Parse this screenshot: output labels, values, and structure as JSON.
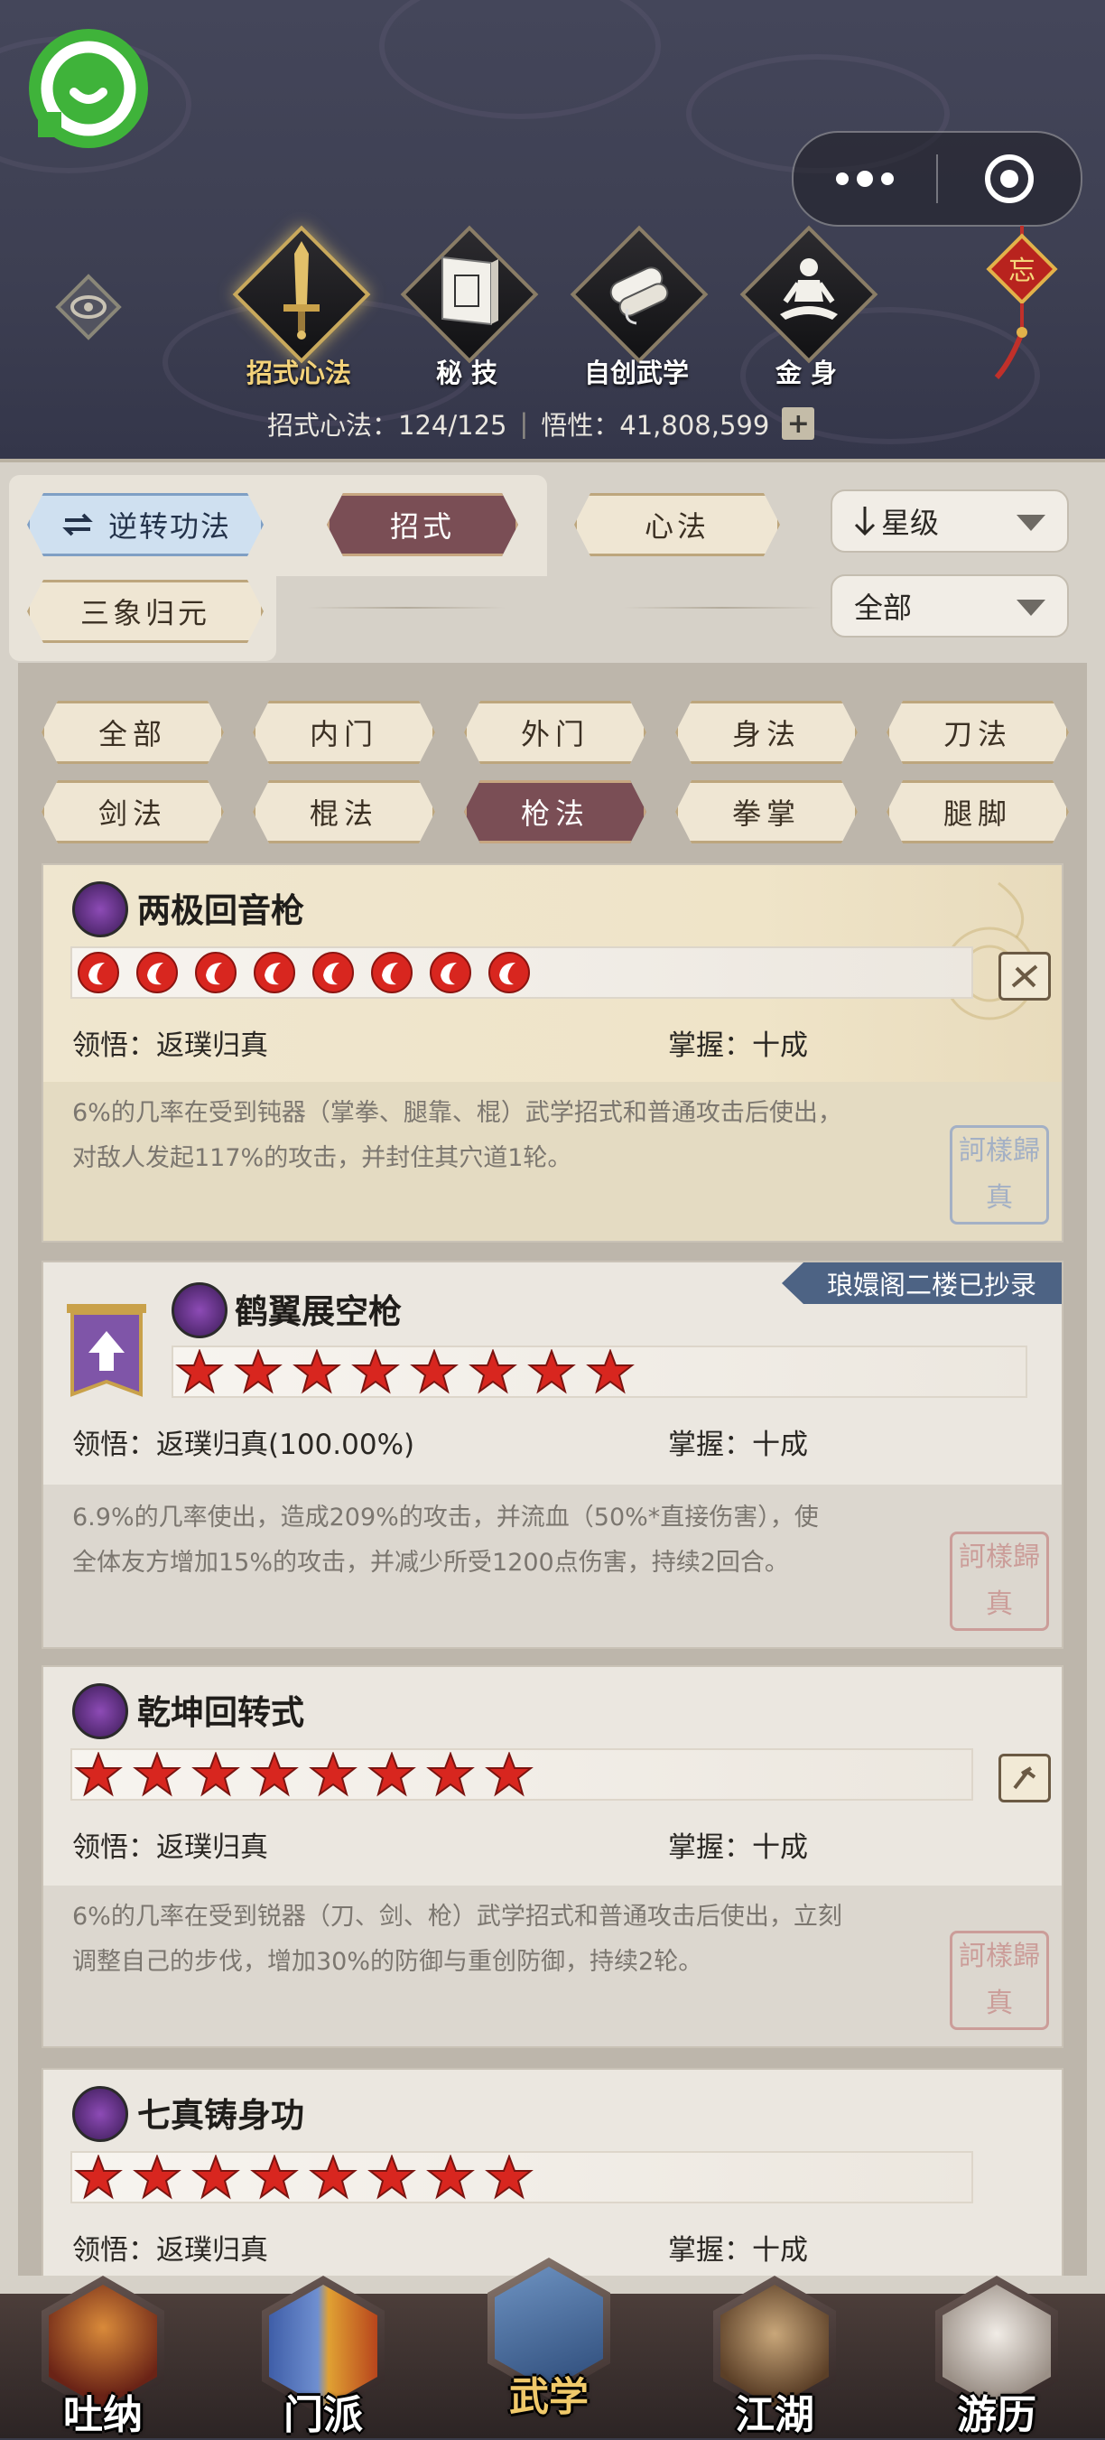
{
  "header": {
    "tabs": [
      {
        "label": "招式心法",
        "icon": "sword-icon",
        "active": true
      },
      {
        "label": "秘 技",
        "icon": "book-icon",
        "active": false
      },
      {
        "label": "自创武学",
        "icon": "scroll-icon",
        "active": false
      },
      {
        "label": "金 身",
        "icon": "meditation-icon",
        "active": false
      }
    ],
    "stats": {
      "moves_label": "招式心法：124/125",
      "separator": "|",
      "insight_label": "悟性：41,808,599",
      "plus": "+"
    },
    "knot_char": "忘"
  },
  "toolbar": {
    "reverse": "逆转功法",
    "moves_tab": "招式",
    "heart_tab": "心法",
    "sort_select": "星级",
    "sanxiang": "三象归元",
    "filter_select": "全部"
  },
  "filters": [
    "全部",
    "内门",
    "外门",
    "身法",
    "刀法",
    "剑法",
    "棍法",
    "枪法",
    "拳掌",
    "腿脚"
  ],
  "active_filter": "枪法",
  "skills": [
    {
      "name": "两极回音枪",
      "star_count": 8,
      "star_style": "fire",
      "comprehension": "领悟：返璞归真",
      "mastery": "掌握：十成",
      "desc": [
        "6%的几率在受到钝器（掌拳、腿靠、棍）武学招式和普通攻击后使出，",
        "对敌人发起117%的攻击，并封住其穴道1轮。"
      ],
      "seal": [
        "訶",
        "樣",
        "歸",
        "真"
      ]
    },
    {
      "name": "鹤翼展空枪",
      "ribbon": "琅嬛阁二楼已抄录",
      "star_count": 8,
      "star_style": "red",
      "comprehension": "领悟：返璞归真(100.00%)",
      "mastery": "掌握：十成",
      "desc": [
        "6.9%的几率使出，造成209%的攻击，并流血（50%*直接伤害），使",
        "全体友方增加15%的攻击，并减少所受1200点伤害，持续2回合。"
      ],
      "seal": [
        "訶",
        "樣",
        "歸",
        "真"
      ]
    },
    {
      "name": "乾坤回转式",
      "star_count": 8,
      "star_style": "red",
      "comprehension": "领悟：返璞归真",
      "mastery": "掌握：十成",
      "desc": [
        "6%的几率在受到锐器（刀、剑、枪）武学招式和普通攻击后使出，立刻",
        "调整自己的步伐，增加30%的防御与重创防御，持续2轮。"
      ],
      "seal": [
        "訶",
        "樣",
        "歸",
        "真"
      ]
    },
    {
      "name": "七真铸身功",
      "star_count": 8,
      "star_style": "red",
      "comprehension": "领悟：返璞归真",
      "mastery": "掌握：十成"
    }
  ],
  "bottom_nav": [
    {
      "label": "吐纳",
      "icon": "monk-icon",
      "active": false
    },
    {
      "label": "门派",
      "icon": "banners-icon",
      "active": false
    },
    {
      "label": "武学",
      "icon": "manual-icon",
      "active": true
    },
    {
      "label": "江湖",
      "icon": "straw-hat-icon",
      "active": false
    },
    {
      "label": "游历",
      "icon": "horse-icon",
      "active": false
    }
  ],
  "colors": {
    "accent_green": "#3fb33a",
    "star_red": "#d8261f",
    "active_tab": "#7a4e55",
    "ribbon": "#4d6384"
  }
}
